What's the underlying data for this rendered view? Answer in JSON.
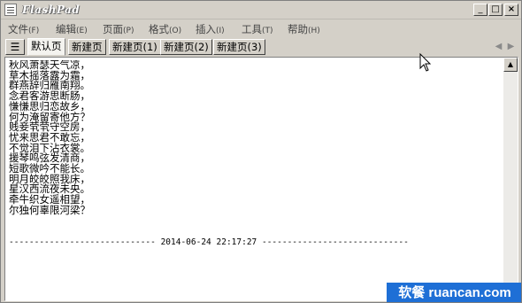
{
  "window": {
    "title": "FlashPad"
  },
  "title_buttons": {
    "minimize": "_",
    "maximize": "□",
    "close": "×"
  },
  "menu": [
    {
      "label": "文件",
      "hotkey": "(F)"
    },
    {
      "label": "编辑",
      "hotkey": "(E)"
    },
    {
      "label": "页面",
      "hotkey": "(P)"
    },
    {
      "label": "格式",
      "hotkey": "(O)"
    },
    {
      "label": "插入",
      "hotkey": "(I)"
    },
    {
      "label": "工具",
      "hotkey": "(T)"
    },
    {
      "label": "帮助",
      "hotkey": "(H)"
    }
  ],
  "tabs": [
    {
      "label": "默认页",
      "active": true
    },
    {
      "label": "新建页",
      "active": false
    },
    {
      "label": "新建页(1)",
      "active": false
    },
    {
      "label": "新建页(2)",
      "active": false
    },
    {
      "label": "新建页(3)",
      "active": false
    }
  ],
  "tab_menu_glyph": "☰",
  "tab_scroll": {
    "left": "◀",
    "right": "▶"
  },
  "editor": {
    "lines": [
      "秋风萧瑟天气凉，",
      "草木摇落露为霜，",
      "群燕辞归雁南翔。",
      "念君客游思断肠，",
      "慊慊思归恋故乡，",
      "何为淹留寄他方？",
      "贱妾茕茕守空房，",
      "忧来思君不敢忘，",
      "不觉泪下沾衣裳。",
      "援琴鸣弦发清商，",
      "短歌微吟不能长。",
      "明月皎皎照我床，",
      "星汉西流夜未央。",
      "牵牛织女遥相望，",
      "尔独何辜限河梁？"
    ],
    "timestamp_line": "----------------------------- 2014-06-24 22:17:27 -----------------------------"
  },
  "scrollbar": {
    "up": "▲",
    "down": "▼"
  },
  "watermark": "软餐 ruancan.com"
}
